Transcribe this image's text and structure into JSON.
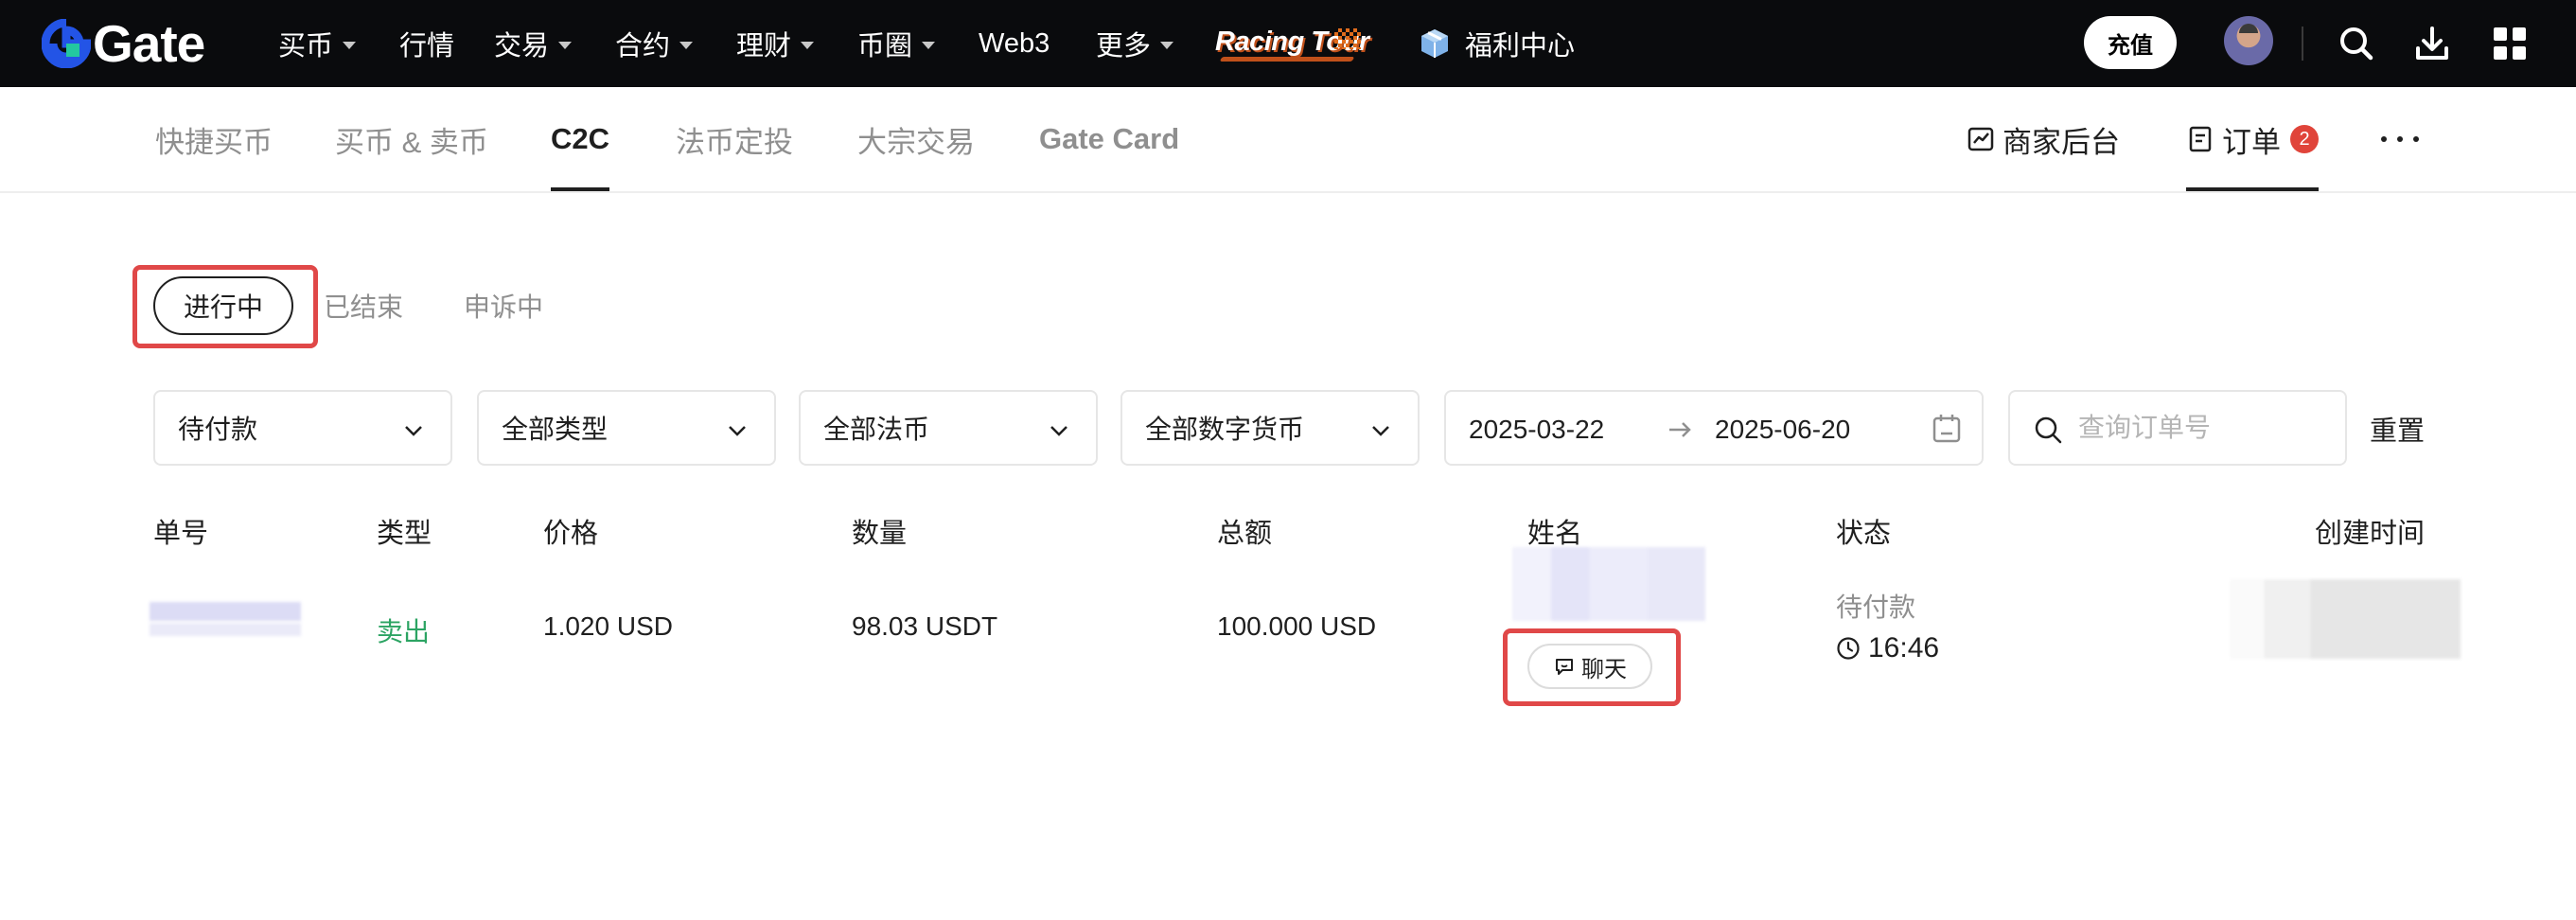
{
  "brand": {
    "logo_text": "Gate"
  },
  "top_nav": {
    "items": [
      {
        "label": "买币",
        "has_dropdown": true
      },
      {
        "label": "行情",
        "has_dropdown": false
      },
      {
        "label": "交易",
        "has_dropdown": true
      },
      {
        "label": "合约",
        "has_dropdown": true
      },
      {
        "label": "理财",
        "has_dropdown": true
      },
      {
        "label": "币圈",
        "has_dropdown": true
      },
      {
        "label": "Web3",
        "has_dropdown": false
      },
      {
        "label": "更多",
        "has_dropdown": true
      }
    ],
    "promo": "Racing Tour",
    "welfare": "福利中心",
    "recharge": "充值",
    "icons": [
      "search-icon",
      "download-icon",
      "apps-grid-icon"
    ]
  },
  "sub_nav": {
    "tabs": [
      "快捷买币",
      "买币 & 卖币",
      "C2C",
      "法币定投",
      "大宗交易",
      "Gate Card"
    ],
    "active_tab": "C2C",
    "merchant": "商家后台",
    "orders": "订单",
    "orders_badge": "2"
  },
  "status_tabs": {
    "items": [
      "进行中",
      "已结束",
      "申诉中"
    ],
    "active": "进行中"
  },
  "filters": {
    "status": "待付款",
    "type": "全部类型",
    "fiat": "全部法币",
    "crypto": "全部数字货币",
    "date_from": "2025-03-22",
    "date_to": "2025-06-20",
    "search_placeholder": "查询订单号",
    "reset": "重置"
  },
  "table": {
    "headers": [
      "单号",
      "类型",
      "价格",
      "数量",
      "总额",
      "姓名",
      "状态",
      "创建时间"
    ],
    "rows": [
      {
        "type": "卖出",
        "price": "1.020 USD",
        "quantity": "98.03 USDT",
        "total": "100.000 USD",
        "chat": "聊天",
        "status": "待付款",
        "countdown": "16:46"
      }
    ]
  },
  "colors": {
    "nav_bg": "#0a0b0d",
    "brand_blue": "#2354e6",
    "sell_green": "#2ca463",
    "badge_red": "#e0443a",
    "highlight_red": "#e04848"
  }
}
